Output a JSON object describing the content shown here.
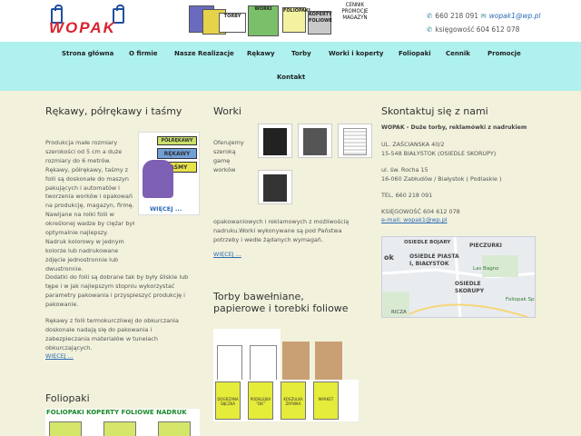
{
  "header": {
    "logo_text": "WOPAK",
    "banner_labels": [
      "TORBY",
      "WORKI",
      "FOLIOPAKI",
      "KOPERTY FOLIOWE"
    ],
    "banner_right": "CENNIK\nPROMOCJE\nMAGAZYN",
    "phone": "660 218 091",
    "email": "wopak1@wp.pl",
    "accounting": "księgowość 604 612 078"
  },
  "nav": {
    "items": [
      "Strona główna",
      "O firmie",
      "Nasze Realizacje",
      "Rękawy",
      "Torby",
      "Worki i koperty",
      "Foliopaki",
      "Cennik",
      "Promocje",
      "Kontakt"
    ]
  },
  "col1": {
    "title": "Rękawy, półrękawy i taśmy",
    "img_tag1": "PÓŁRĘKAWY",
    "img_tag2": "RĘKAWY",
    "img_tag3": "TAŚMY",
    "img_more": "WIĘCEJ ...",
    "p1": "Produkcja małe rozmiary szerokości od 5 cm a duże rozmiary do 6 metrów.",
    "p2": "Rękawy, półrękawy, taśmy z folii są doskonałe do maszyn pakujących i automatów i tworzenia worków i opakowań na produkcję, magazyn, firmę. Nawijane na rolki folii w określonej wadze by ciężar był optymalnie najlepszy.",
    "p3": "Nadruk kolorowy w jednym kolorze lub nadrukowane zdjęcie jednostronnie lub dwustronnie.",
    "p4": "Dodatki do folii są dobrane tak by były śliskie lub tępe i w jak najlepszym stopniu wykorzystać parametry pakowania i przyspieszyć produkcję i pakowanie.",
    "p5": "Rękawy z folii termokurczliwej do obkurczania doskonale nadają się do pakowania i zabezpieczania materiałów w tunelach obkurczających.",
    "more": "WIĘCEJ ...",
    "title2": "Foliopaki",
    "foliopaki_banner": "FOLIOPAKI KOPERTY FOLIOWE  NADRUK"
  },
  "col2": {
    "title": "Worki",
    "lead": "Oferujemy szeroką gamę worków",
    "body": "opakowaniowych i reklamowych z możliwością nadruku.Worki wykonywane są pod Państwa potrzeby i wedle żądanych wymagań.",
    "more": "WIĘCEJ ...",
    "title2": "Torby bawełniane, papierowe i torebki foliowe",
    "bag_labels": [
      "DOGRZANA ŚĄCZKA",
      "PODKLEJKA \"DK\"",
      "KOSZULKA ZRYWKA",
      "MARKET"
    ]
  },
  "col3": {
    "title": "Skontaktuj się z nami",
    "company": "WOPAK - Duże torby, reklamówki z nadrukiem",
    "addr1": "UL. ZAŚCIANSKA 40/2",
    "addr2": "15-548 BIAŁYSTOK (OSIEDLE SKORUPY)",
    "addr3": "ul. św. Rocha 15",
    "addr4": "16-060 Zabłudów / Białystok ( Podlaskie )",
    "tel": "TEL. 660 218 091",
    "acc": "KSIĘGOWOŚĆ 604 612 078",
    "email": "e-mail: wopak1@wp.pl",
    "map_labels": [
      "OSIEDLE BOJARY",
      "PIECZURKI",
      "OSIEDLE PIASTA I, BIAŁYSTOK",
      "OSIEDLE SKORUPY",
      "Las Bagno",
      "Foliopak Sp",
      "RICZA",
      "ok"
    ]
  },
  "colors": {
    "nav_bg": "#aef1ef",
    "page_bg": "#f2f1dc",
    "link": "#2c6bb5",
    "logo_red": "#d9232d"
  }
}
